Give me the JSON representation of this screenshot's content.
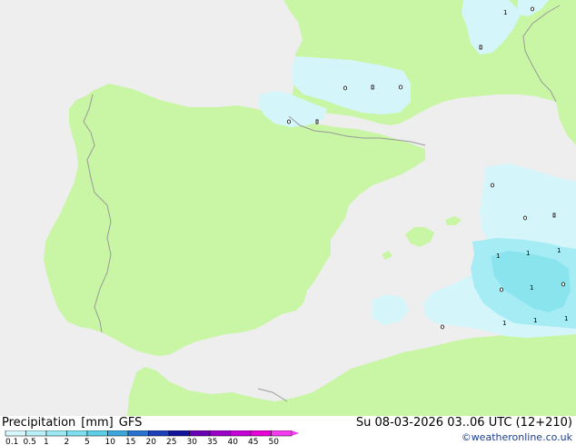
{
  "header": {
    "title_parts": [
      "Precipitation",
      "[mm]",
      "GFS"
    ],
    "run_info": "Su 08-03-2026 03..06 UTC (12+210)",
    "credit": "©weatheronline.co.uk"
  },
  "legend": {
    "values": [
      "0.1",
      "0.5",
      "1",
      "2",
      "5",
      "10",
      "15",
      "20",
      "25",
      "30",
      "35",
      "40",
      "45",
      "50"
    ],
    "colors": [
      "#d6f7fb",
      "#b9f0f7",
      "#9be8f2",
      "#7ddfee",
      "#5ccfe6",
      "#3ba6dc",
      "#2a72d0",
      "#1e3fb8",
      "#14149a",
      "#6a00b4",
      "#9a00c8",
      "#c400d6",
      "#e800d8",
      "#f43cf0"
    ]
  },
  "map": {
    "colors": {
      "sea": "#eeeeee",
      "land": "#c8f6a4",
      "rain_light": "#d4f6fb",
      "rain_medium": "#a6ecf4",
      "rain_strong": "#8ae4ee",
      "border": "#9a9a9a"
    },
    "rain_labels": [
      "1",
      "1",
      "1",
      "1",
      "1",
      "1",
      "1",
      "1"
    ]
  }
}
